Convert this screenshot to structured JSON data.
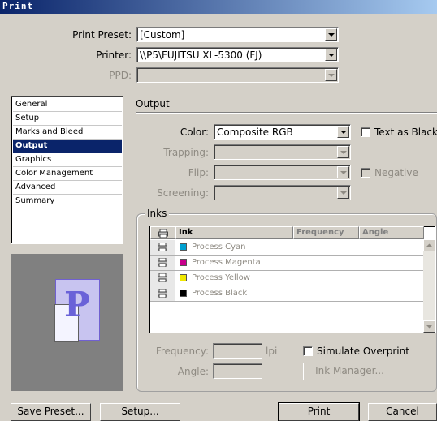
{
  "window": {
    "title": "Print"
  },
  "top": {
    "print_preset_label": "Print Preset:",
    "print_preset_value": "[Custom]",
    "printer_label": "Printer:",
    "printer_value": "\\\\P5\\FUJITSU XL-5300 (FJ)",
    "ppd_label": "PPD:",
    "ppd_value": ""
  },
  "sidebar": {
    "items": [
      {
        "label": "General"
      },
      {
        "label": "Setup"
      },
      {
        "label": "Marks and Bleed"
      },
      {
        "label": "Output"
      },
      {
        "label": "Graphics"
      },
      {
        "label": "Color Management"
      },
      {
        "label": "Advanced"
      },
      {
        "label": "Summary"
      }
    ],
    "selected": "Output"
  },
  "preview": {
    "glyph": "P"
  },
  "output": {
    "section_title": "Output",
    "color_label": "Color:",
    "color_value": "Composite RGB",
    "text_as_black_label": "Text as Black",
    "trapping_label": "Trapping:",
    "flip_label": "Flip:",
    "negative_label": "Negative",
    "screening_label": "Screening:"
  },
  "inks": {
    "group_label": "Inks",
    "headers": {
      "ink": "Ink",
      "frequency": "Frequency",
      "angle": "Angle"
    },
    "rows": [
      {
        "name": "Process Cyan",
        "color": "#00a0d0"
      },
      {
        "name": "Process Magenta",
        "color": "#c8008c"
      },
      {
        "name": "Process Yellow",
        "color": "#f0e800"
      },
      {
        "name": "Process Black",
        "color": "#000000"
      }
    ],
    "frequency_label": "Frequency:",
    "lpi_label": "lpi",
    "angle_label": "Angle:",
    "simulate_overprint_label": "Simulate Overprint",
    "ink_manager_label": "Ink Manager..."
  },
  "buttons": {
    "save_preset": "Save Preset...",
    "setup": "Setup...",
    "print": "Print",
    "cancel": "Cancel"
  },
  "colors": {
    "title_bar": "#0a246a",
    "selection": "#0a246a",
    "face": "#d4d0c8"
  }
}
